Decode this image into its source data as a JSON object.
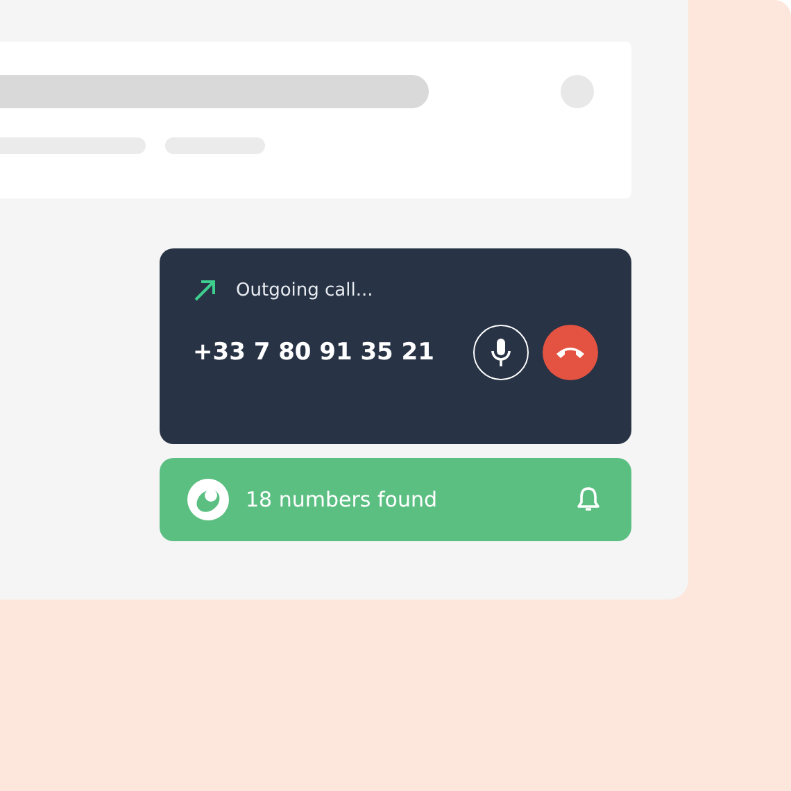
{
  "call": {
    "status": "Outgoing call...",
    "number": "+33 7 80 91 35 21"
  },
  "lookup": {
    "text": "18 numbers found"
  }
}
